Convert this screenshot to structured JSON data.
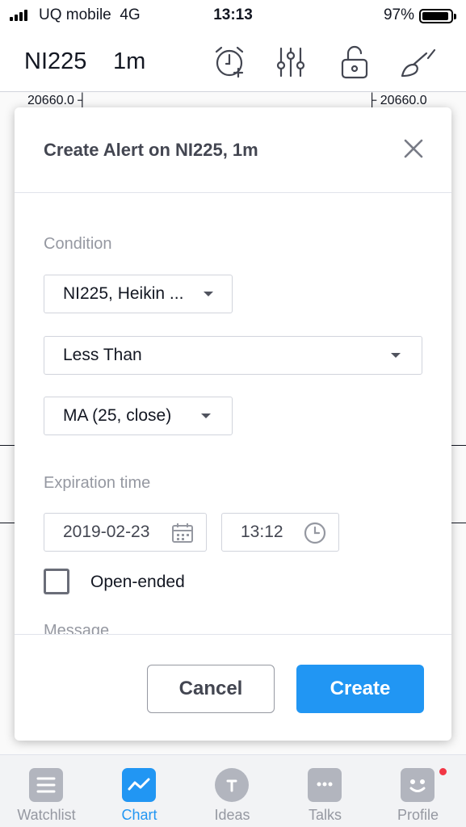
{
  "status_bar": {
    "carrier": "UQ mobile",
    "network": "4G",
    "time": "13:13",
    "battery_percent": "97%"
  },
  "header": {
    "symbol": "NI225",
    "interval": "1m",
    "icons": [
      "alarm-add-icon",
      "indicators-icon",
      "unlock-icon",
      "brush-icon"
    ]
  },
  "chart": {
    "price_left": "20660.0",
    "price_right": "20660.0"
  },
  "dialog": {
    "title": "Create Alert on NI225, 1m",
    "condition_label": "Condition",
    "source_select": "NI225, Heikin ...",
    "operator_select": "Less Than",
    "target_select": "MA (25, close)",
    "expiration_label": "Expiration time",
    "date_value": "2019-02-23",
    "time_value": "13:12",
    "open_ended_label": "Open-ended",
    "open_ended_checked": false,
    "message_label": "Message",
    "cancel_label": "Cancel",
    "create_label": "Create",
    "accent_color": "#2196f3"
  },
  "tabbar": {
    "items": [
      {
        "label": "Watchlist",
        "icon": "watchlist-icon",
        "active": false
      },
      {
        "label": "Chart",
        "icon": "chart-icon",
        "active": true
      },
      {
        "label": "Ideas",
        "icon": "ideas-icon",
        "active": false
      },
      {
        "label": "Talks",
        "icon": "talks-icon",
        "active": false
      },
      {
        "label": "Profile",
        "icon": "profile-icon",
        "active": false,
        "badge": true
      }
    ]
  }
}
